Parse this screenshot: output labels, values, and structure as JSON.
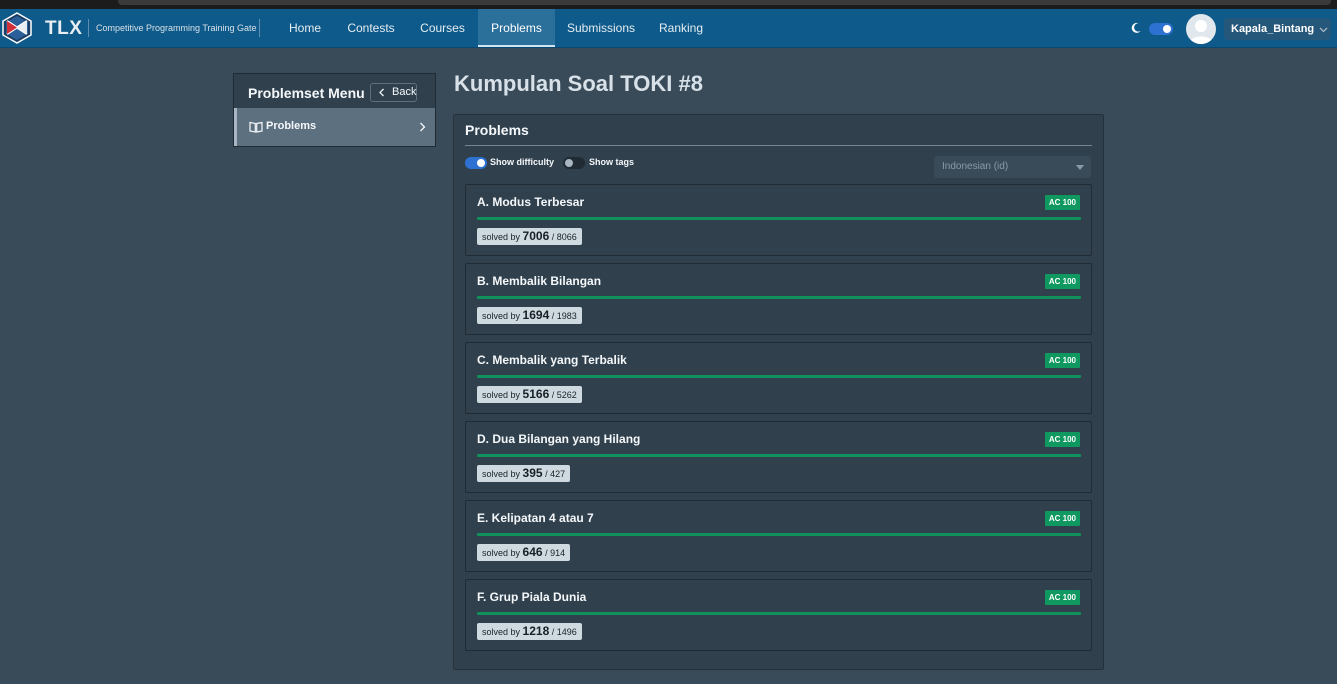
{
  "navbar": {
    "brand": "TLX",
    "tagline": "Competitive Programming Training Gate",
    "items": [
      {
        "label": "Home",
        "active": false
      },
      {
        "label": "Contests",
        "active": false
      },
      {
        "label": "Courses",
        "active": false
      },
      {
        "label": "Problems",
        "active": true
      },
      {
        "label": "Submissions",
        "active": false
      },
      {
        "label": "Ranking",
        "active": false
      }
    ],
    "dark_mode": true,
    "username": "Kapala_Bintang"
  },
  "sidebar": {
    "title": "Problemset Menu",
    "back_label": "Back",
    "items": [
      {
        "label": "Problems",
        "active": true
      }
    ]
  },
  "main": {
    "title": "Kumpulan Soal TOKI #8",
    "card_title": "Problems",
    "show_difficulty_label": "Show difficulty",
    "show_difficulty": true,
    "show_tags_label": "Show tags",
    "show_tags": false,
    "language": "Indonesian (id)",
    "solved_prefix": "solved by",
    "problems": [
      {
        "name": "A. Modus Terbesar",
        "verdict": "AC 100",
        "progress": 1.0,
        "solved": "7006",
        "total": "/ 8066"
      },
      {
        "name": "B. Membalik Bilangan",
        "verdict": "AC 100",
        "progress": 1.0,
        "solved": "1694",
        "total": "/ 1983"
      },
      {
        "name": "C. Membalik yang Terbalik",
        "verdict": "AC 100",
        "progress": 1.0,
        "solved": "5166",
        "total": "/ 5262"
      },
      {
        "name": "D. Dua Bilangan yang Hilang",
        "verdict": "AC 100",
        "progress": 1.0,
        "solved": "395",
        "total": "/ 427"
      },
      {
        "name": "E. Kelipatan 4 atau 7",
        "verdict": "AC 100",
        "progress": 1.0,
        "solved": "646",
        "total": "/ 914"
      },
      {
        "name": "F. Grup Piala Dunia",
        "verdict": "AC 100",
        "progress": 1.0,
        "solved": "1218",
        "total": "/ 1496"
      }
    ]
  },
  "colors": {
    "navbar": "#0e5a8a",
    "background": "#394b59",
    "card": "#30404d",
    "accepted": "#0f9960",
    "toggle_on": "#2d72d2"
  }
}
